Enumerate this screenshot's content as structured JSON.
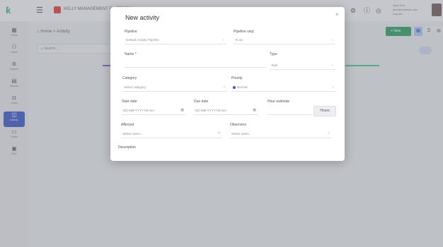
{
  "topbar": {
    "brand_name": "KELLY MANAGEMENT PLATFORM",
    "user_line_1": "Jane Doe",
    "user_line_2": "jane@example.com",
    "user_line_3": "Log out"
  },
  "sidebar": {
    "items": [
      {
        "label": "Home",
        "icon": "calendar-icon"
      },
      {
        "label": "Users",
        "icon": "users-icon"
      },
      {
        "label": "Explore",
        "icon": "compass-icon"
      },
      {
        "label": "Reports",
        "icon": "document-icon"
      },
      {
        "label": "Chats",
        "icon": "chat-icon"
      },
      {
        "label": "Activity",
        "icon": "activity-icon"
      },
      {
        "label": "Trucks",
        "icon": "truck-icon"
      },
      {
        "label": "Files",
        "icon": "folder-icon"
      }
    ]
  },
  "breadcrumb": {
    "home": "Home",
    "separator": ">",
    "current": "Activity"
  },
  "search": {
    "placeholder": "Search..."
  },
  "toolbar": {
    "new_label": "+ New"
  },
  "modal": {
    "title": "New activity",
    "close": "×",
    "pipeline": {
      "label": "Pipeline",
      "value": "Default Activity Pipeline"
    },
    "pipeline_step": {
      "label": "Pipeline step",
      "value": "To do"
    },
    "name": {
      "label": "Name *",
      "value": ""
    },
    "type": {
      "label": "Type",
      "value": "Task"
    },
    "category": {
      "label": "Category",
      "value": "Select category"
    },
    "priority": {
      "label": "Priority",
      "value": "Normal"
    },
    "start_date": {
      "label": "Start date",
      "value": "DD-MM-YYYY hh:mm"
    },
    "due_date": {
      "label": "Due date",
      "value": "DD-MM-YYYY hh:mm"
    },
    "hour_estimate": {
      "label": "Hour estimate",
      "value": "",
      "button": "Hours"
    },
    "affected": {
      "label": "Affected",
      "value": "Select users..."
    },
    "observers": {
      "label": "Observers",
      "value": "Select users..."
    },
    "description": {
      "label": "Description"
    }
  },
  "colors": {
    "accent": "#3a56c4",
    "primary_button": "#2e9a63",
    "brand": "#d9413b"
  }
}
